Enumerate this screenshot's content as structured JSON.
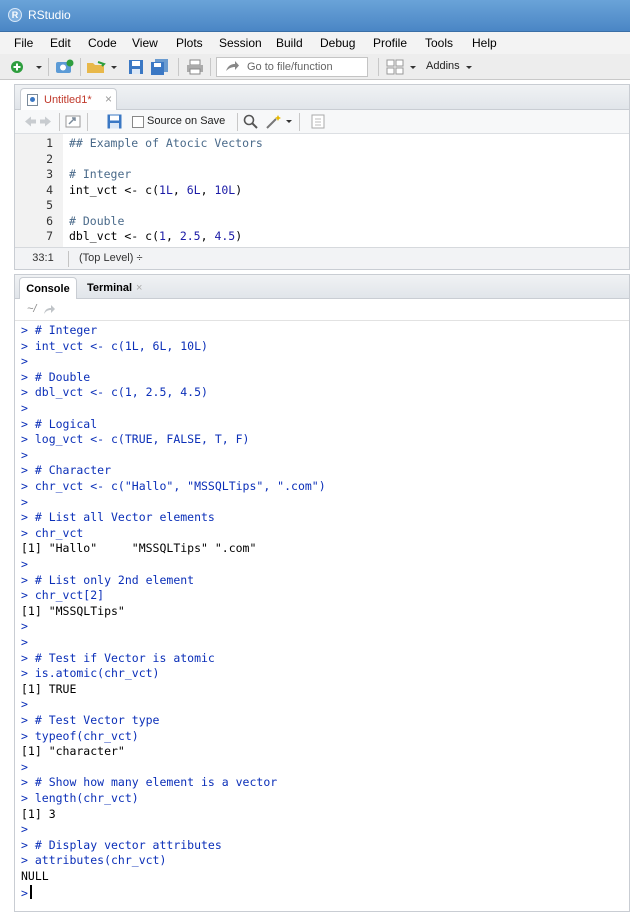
{
  "window": {
    "title": "RStudio",
    "logo": "R"
  },
  "menubar": {
    "items": [
      "File",
      "Edit",
      "Code",
      "View",
      "Plots",
      "Session",
      "Build",
      "Debug",
      "Profile",
      "Tools",
      "Help"
    ]
  },
  "toolbar": {
    "goto_placeholder": "Go to file/function",
    "addins_label": "Addins"
  },
  "source": {
    "tab_label": "Untitled1*",
    "tab_close": "×",
    "source_on_save_label": "Source on Save",
    "status_position": "33:1",
    "status_scope": "(Top Level) ÷",
    "lines": [
      {
        "num": "1",
        "text": "## Example of Atocic Vectors",
        "kind": "comment"
      },
      {
        "num": "2",
        "text": "",
        "kind": "text"
      },
      {
        "num": "3",
        "text": "# Integer",
        "kind": "comment"
      },
      {
        "num": "4",
        "text": "int_vct <- c(1L, 6L, 10L)",
        "kind": "code"
      },
      {
        "num": "5",
        "text": "",
        "kind": "text"
      },
      {
        "num": "6",
        "text": "# Double",
        "kind": "comment"
      },
      {
        "num": "7",
        "text": "dbl_vct <- c(1, 2.5, 4.5)",
        "kind": "code"
      }
    ]
  },
  "console": {
    "tabs": [
      "Console",
      "Terminal"
    ],
    "tab_close": "×",
    "path": "~/",
    "lines": [
      {
        "text": "> # Integer",
        "kind": "input"
      },
      {
        "text": "> int_vct <- c(1L, 6L, 10L)",
        "kind": "input"
      },
      {
        "text": ">",
        "kind": "input"
      },
      {
        "text": "> # Double",
        "kind": "input"
      },
      {
        "text": "> dbl_vct <- c(1, 2.5, 4.5)",
        "kind": "input"
      },
      {
        "text": ">",
        "kind": "input"
      },
      {
        "text": "> # Logical",
        "kind": "input"
      },
      {
        "text": "> log_vct <- c(TRUE, FALSE, T, F)",
        "kind": "input"
      },
      {
        "text": ">",
        "kind": "input"
      },
      {
        "text": "> # Character",
        "kind": "input"
      },
      {
        "text": "> chr_vct <- c(\"Hallo\", \"MSSQLTips\", \".com\")",
        "kind": "input"
      },
      {
        "text": ">",
        "kind": "input"
      },
      {
        "text": "> # List all Vector elements",
        "kind": "input"
      },
      {
        "text": "> chr_vct",
        "kind": "input"
      },
      {
        "text": "[1] \"Hallo\"     \"MSSQLTips\" \".com\"",
        "kind": "output"
      },
      {
        "text": ">",
        "kind": "input"
      },
      {
        "text": "> # List only 2nd element",
        "kind": "input"
      },
      {
        "text": "> chr_vct[2]",
        "kind": "input"
      },
      {
        "text": "[1] \"MSSQLTips\"",
        "kind": "output"
      },
      {
        "text": ">",
        "kind": "input"
      },
      {
        "text": ">",
        "kind": "input"
      },
      {
        "text": "> # Test if Vector is atomic",
        "kind": "input"
      },
      {
        "text": "> is.atomic(chr_vct)",
        "kind": "input"
      },
      {
        "text": "[1] TRUE",
        "kind": "output"
      },
      {
        "text": ">",
        "kind": "input"
      },
      {
        "text": "> # Test Vector type",
        "kind": "input"
      },
      {
        "text": "> typeof(chr_vct)",
        "kind": "input"
      },
      {
        "text": "[1] \"character\"",
        "kind": "output"
      },
      {
        "text": ">",
        "kind": "input"
      },
      {
        "text": "> # Show how many element is a vector",
        "kind": "input"
      },
      {
        "text": "> length(chr_vct)",
        "kind": "input"
      },
      {
        "text": "[1] 3",
        "kind": "output"
      },
      {
        "text": ">",
        "kind": "input"
      },
      {
        "text": "> # Display vector attributes",
        "kind": "input"
      },
      {
        "text": "> attributes(chr_vct)",
        "kind": "input"
      },
      {
        "text": "NULL",
        "kind": "output"
      }
    ],
    "prompt": ">"
  },
  "colors": {
    "titlebar": "#4a86c5",
    "console_input": "#0b2fb8",
    "comment": "#4a6a8a",
    "number": "#1a1aa6",
    "tab_modified": "#c0392b"
  }
}
